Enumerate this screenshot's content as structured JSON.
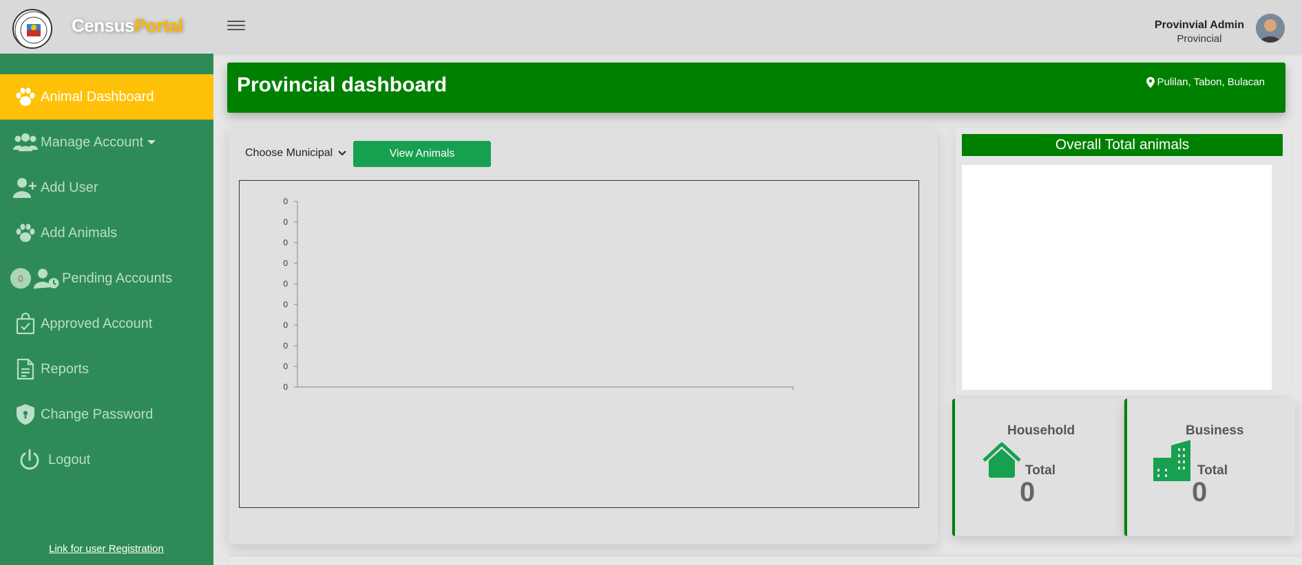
{
  "brand": {
    "part1": "Census",
    "part2": "Portal"
  },
  "user": {
    "name": "Provinvial Admin",
    "role": "Provincial"
  },
  "sidebar": {
    "items": [
      {
        "label": "Animal Dashboard",
        "icon": "paw-icon",
        "active": true
      },
      {
        "label": "Manage Account",
        "icon": "users-icon",
        "has_dropdown": true
      },
      {
        "label": "Add User",
        "icon": "user-plus-icon"
      },
      {
        "label": "Add Animals",
        "icon": "paw-icon"
      },
      {
        "label": "Pending Accounts",
        "icon": "user-clock-icon",
        "badge": "0"
      },
      {
        "label": "Approved Account",
        "icon": "bag-check-icon"
      },
      {
        "label": "Reports",
        "icon": "document-icon"
      },
      {
        "label": "Change Password",
        "icon": "shield-lock-icon"
      },
      {
        "label": "Logout",
        "icon": "power-icon"
      }
    ],
    "registration_link": "Link for user Registration"
  },
  "header": {
    "title": "Provincial dashboard",
    "location": "Pulilan, Tabon, Bulacan"
  },
  "filter": {
    "municipal_select": "Choose Municipal",
    "view_button": "View Animals"
  },
  "chart_data": {
    "type": "bar",
    "categories": [],
    "values": [],
    "y_ticks": [
      "0",
      "0",
      "0",
      "0",
      "0",
      "0",
      "0",
      "0",
      "0",
      "0"
    ]
  },
  "overall": {
    "title": "Overall Total animals"
  },
  "cards": {
    "household": {
      "title": "Household",
      "total_label": "Total",
      "value": "0"
    },
    "business": {
      "title": "Business",
      "total_label": "Total",
      "value": "0"
    }
  },
  "colors": {
    "primary_green": "#008000",
    "sidebar_green": "#2e8b57",
    "active_yellow": "#ffc107",
    "button_green": "#17a050",
    "brand_orange": "#ffb400"
  }
}
